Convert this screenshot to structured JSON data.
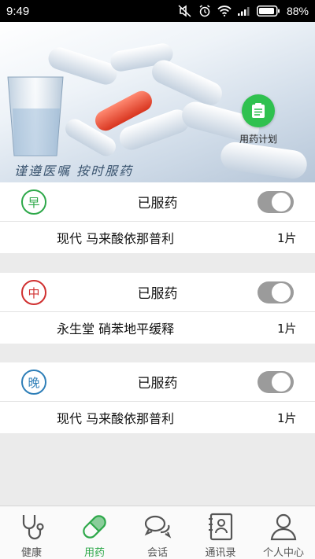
{
  "status_bar": {
    "time": "9:49",
    "battery": "88%"
  },
  "banner": {
    "slogan": "谨遵医嘱  按时服药",
    "plan_button_label": "用药计划"
  },
  "schedule": [
    {
      "period": "早",
      "color": "#2ea84a",
      "status": "已服药",
      "taken": false,
      "medicine": "现代 马来酸依那普利",
      "quantity": "1片"
    },
    {
      "period": "中",
      "color": "#d03030",
      "status": "已服药",
      "taken": false,
      "medicine": "永生堂 硝苯地平缓释",
      "quantity": "1片"
    },
    {
      "period": "晚",
      "color": "#2f7fb8",
      "status": "已服药",
      "taken": false,
      "medicine": "现代 马来酸依那普利",
      "quantity": "1片"
    }
  ],
  "nav": {
    "items": [
      {
        "label": "健康",
        "icon": "stethoscope-icon",
        "active": false
      },
      {
        "label": "用药",
        "icon": "pill-icon",
        "active": true
      },
      {
        "label": "会话",
        "icon": "chat-icon",
        "active": false
      },
      {
        "label": "通讯录",
        "icon": "contacts-icon",
        "active": false
      },
      {
        "label": "个人中心",
        "icon": "person-icon",
        "active": false
      }
    ]
  },
  "colors": {
    "accent": "#2ea84a",
    "toggle_off": "#9b9b9b"
  }
}
